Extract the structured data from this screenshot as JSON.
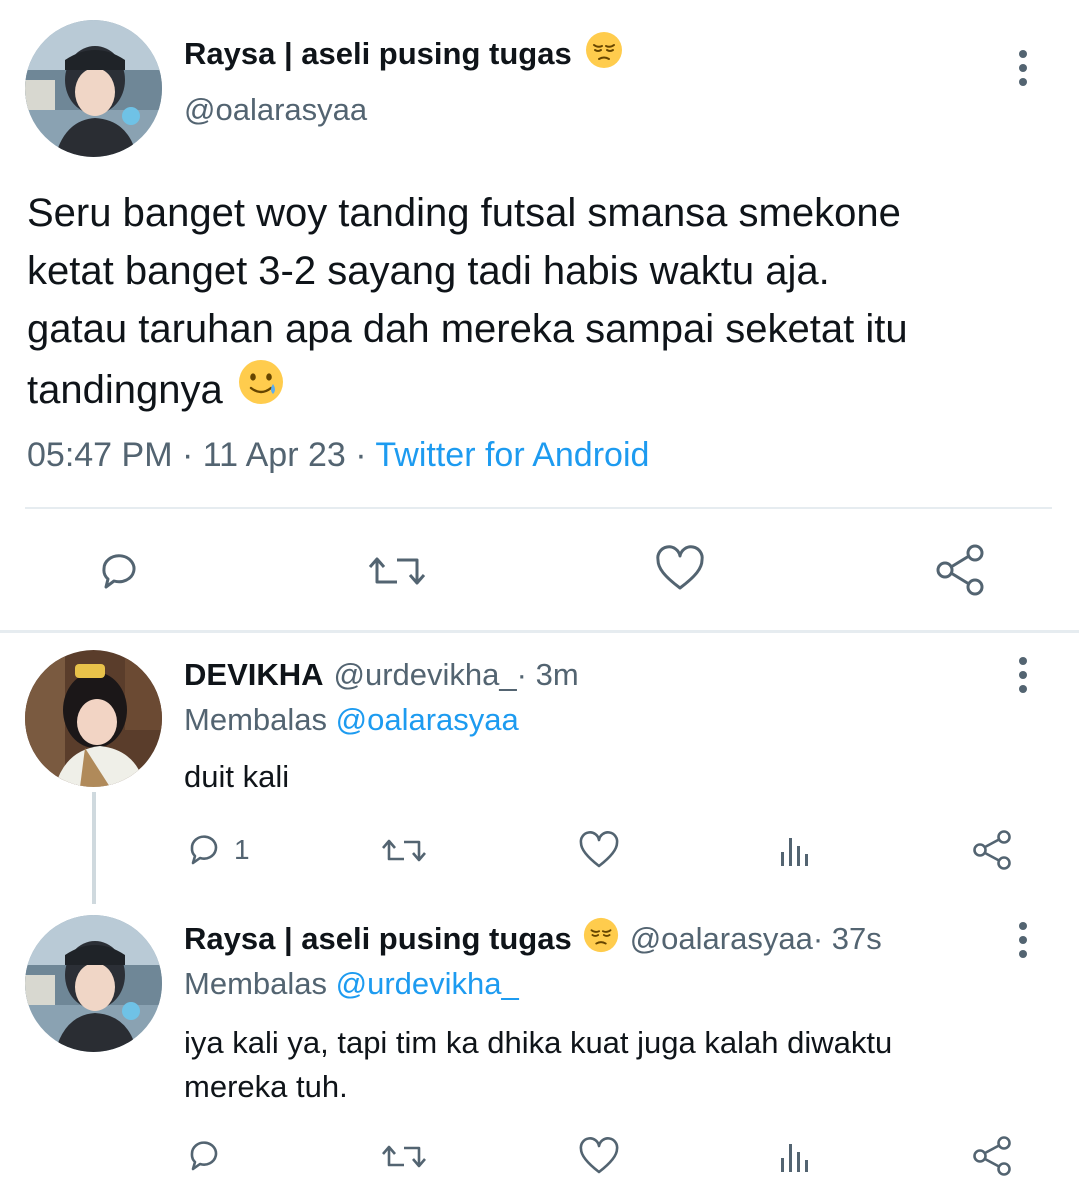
{
  "main_tweet": {
    "display_name": "Raysa | aseli pusing tugas",
    "handle": "@oalarasyaa",
    "text_lines": [
      "Seru banget woy tanding futsal smansa smekone",
      "ketat banget 3-2 sayang tadi habis waktu aja.",
      "gatau taruhan apa dah mereka sampai seketat itu",
      "tandingnya"
    ],
    "time": "05:47 PM",
    "separator": " · ",
    "date": "11 Apr 23",
    "source": "Twitter for Android",
    "actions": [
      "reply-icon",
      "retweet-icon",
      "like-icon",
      "share-icon"
    ]
  },
  "replies": [
    {
      "display_name": "DEVIKHA",
      "handle": "@urdevikha_",
      "time": " · 3m",
      "replying_prefix": "Membalas",
      "replying_to": "@oalarasyaa",
      "text_lines": [
        "duit kali"
      ],
      "reply_count": "1"
    },
    {
      "display_name": "Raysa | aseli pusing tugas",
      "handle": "@oalarasyaa",
      "time": " · 37s",
      "replying_prefix": "Membalas",
      "replying_to": "@urdevikha_",
      "text_lines": [
        "iya kali ya, tapi tim ka dhika kuat juga kalah diwaktu",
        "mereka tuh."
      ]
    }
  ],
  "colors": {
    "text": "#0f1419",
    "secondary": "#536471",
    "accent": "#1d9bf0",
    "divider": "#e6ecf0",
    "thread_line": "#cfd9de"
  }
}
